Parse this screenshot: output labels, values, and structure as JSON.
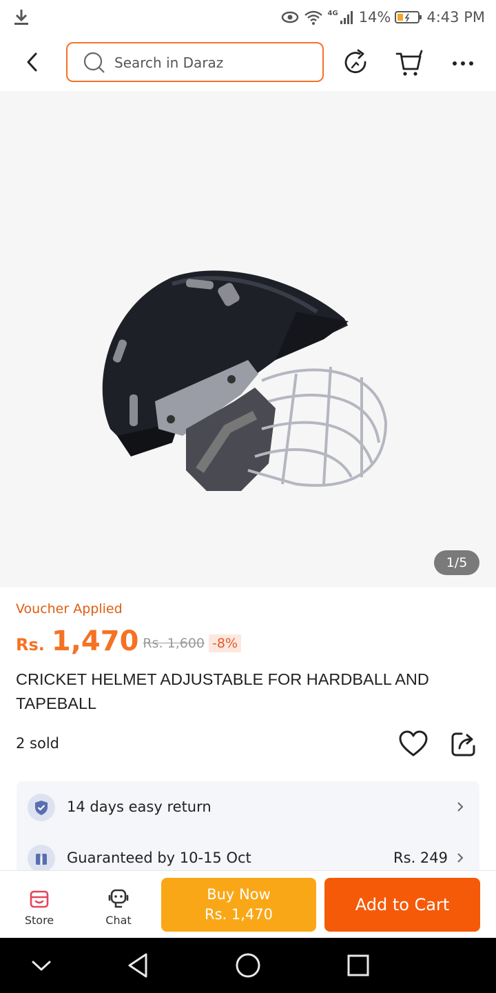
{
  "status_bar": {
    "network": "4G",
    "battery": "14%",
    "time": "4:43 PM"
  },
  "header": {
    "search_placeholder": "Search in Daraz",
    "icons": [
      "back-arrow-icon",
      "search-icon",
      "refresh-icon",
      "cart-icon",
      "more-icon"
    ]
  },
  "gallery": {
    "counter": "1/5"
  },
  "product": {
    "voucher_label": "Voucher Applied",
    "currency": "Rs.",
    "price": "1,470",
    "original_price": "Rs. 1,600",
    "discount": "-8%",
    "title": "CRICKET HELMET ADJUSTABLE FOR HARDBALL AND TAPEBALL",
    "sold": "2 sold"
  },
  "services": [
    {
      "label": "14 days easy return",
      "value": "",
      "icon": "shield-check-icon"
    },
    {
      "label": "Guaranteed by 10-15 Oct",
      "value": "Rs. 249",
      "icon": "delivery-box-icon"
    }
  ],
  "action_bar": {
    "store_label": "Store",
    "chat_label": "Chat",
    "buy_now_label": "Buy Now",
    "buy_now_price": "Rs. 1,470",
    "add_to_cart_label": "Add to Cart"
  },
  "colors": {
    "accent": "#f57224",
    "buy_now": "#faa717",
    "add_to_cart": "#f55a09"
  }
}
